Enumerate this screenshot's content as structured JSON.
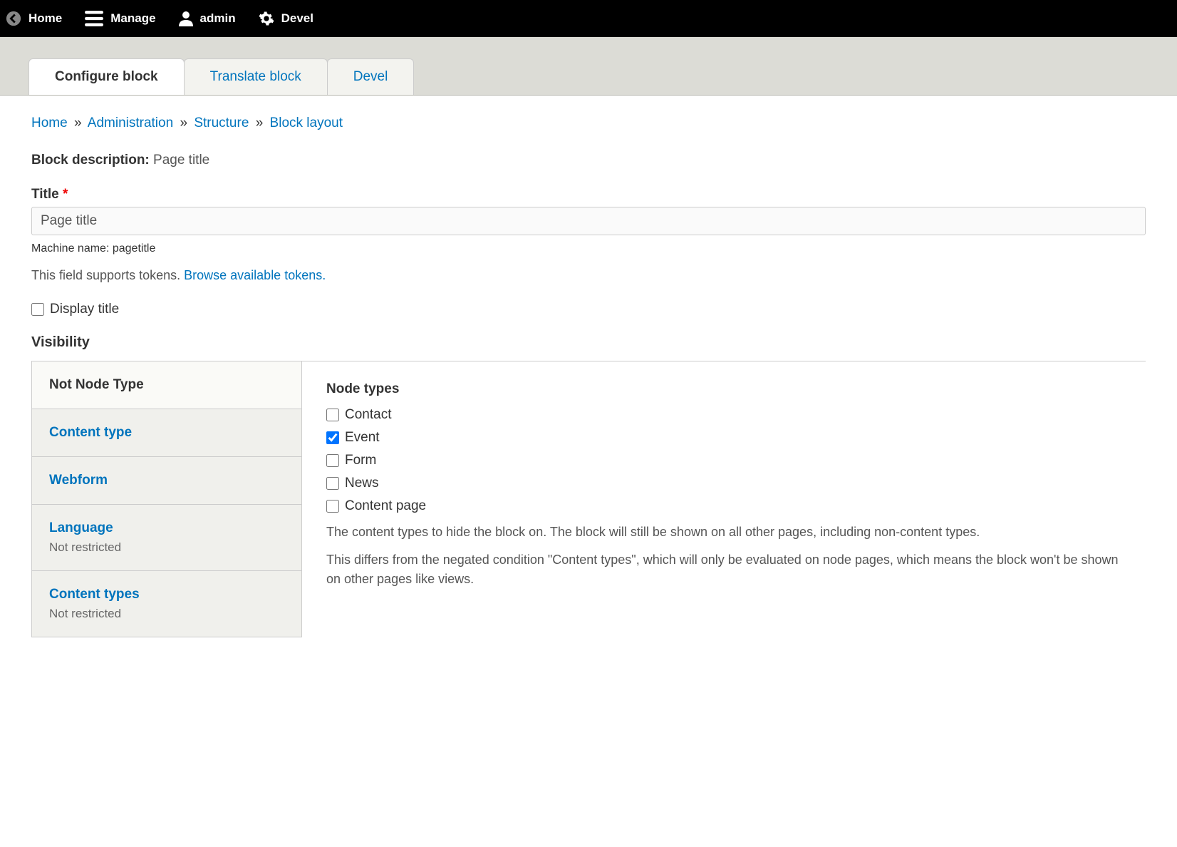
{
  "toolbar": {
    "home": "Home",
    "manage": "Manage",
    "admin": "admin",
    "devel": "Devel"
  },
  "tabs": [
    {
      "label": "Configure block",
      "active": true
    },
    {
      "label": "Translate block",
      "active": false
    },
    {
      "label": "Devel",
      "active": false
    }
  ],
  "breadcrumb": {
    "items": [
      "Home",
      "Administration",
      "Structure",
      "Block layout"
    ],
    "sep": "»"
  },
  "block_description": {
    "label": "Block description:",
    "value": "Page title"
  },
  "title_field": {
    "label": "Title",
    "value": "Page title",
    "machine_name_label": "Machine name:",
    "machine_name_value": "pagetitle",
    "help_text": "This field supports tokens.",
    "help_link": "Browse available tokens."
  },
  "display_title": {
    "label": "Display title",
    "checked": false
  },
  "visibility": {
    "heading": "Visibility",
    "sidebar": [
      {
        "title": "Not Node Type",
        "sub": "",
        "active": true
      },
      {
        "title": "Content type",
        "sub": "",
        "active": false
      },
      {
        "title": "Webform",
        "sub": "",
        "active": false
      },
      {
        "title": "Language",
        "sub": "Not restricted",
        "active": false
      },
      {
        "title": "Content types",
        "sub": "Not restricted",
        "active": false
      }
    ],
    "panel": {
      "heading": "Node types",
      "options": [
        {
          "label": "Contact",
          "checked": false
        },
        {
          "label": "Event",
          "checked": true
        },
        {
          "label": "Form",
          "checked": false
        },
        {
          "label": "News",
          "checked": false
        },
        {
          "label": "Content page",
          "checked": false
        }
      ],
      "help1": "The content types to hide the block on. The block will still be shown on all other pages, including non-content types.",
      "help2": "This differs from the negated condition \"Content types\", which will only be evaluated on node pages, which means the block won't be shown on other pages like views."
    }
  }
}
